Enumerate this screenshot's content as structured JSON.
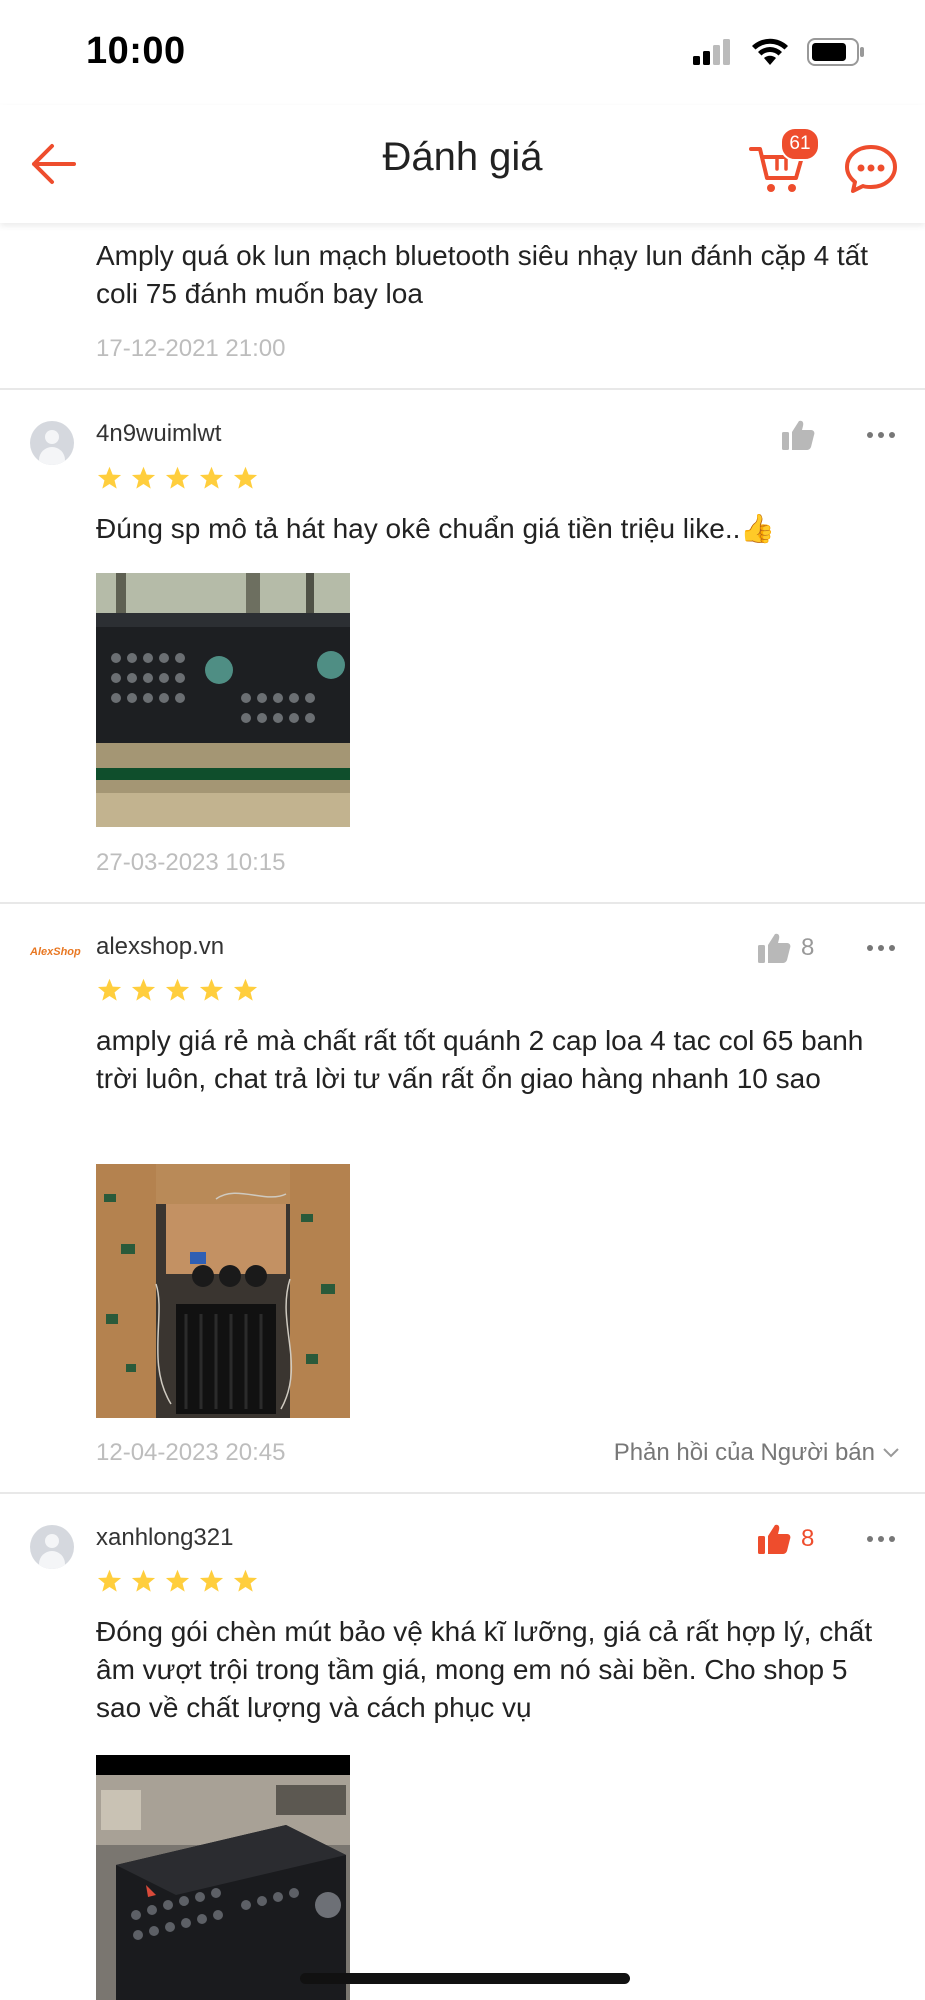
{
  "status_bar": {
    "time": "10:00"
  },
  "header": {
    "title": "Đánh giá",
    "cart_count": "61"
  },
  "colors": {
    "accent": "#ee4d2d",
    "star": "#ffce3d",
    "muted": "#bdbdbd"
  },
  "reviews": [
    {
      "text": "Amply quá ok lun mạch bluetooth siêu nhạy lun đánh cặp 4 tất coli 75 đánh muốn bay loa",
      "date": "17-12-2021 21:00"
    },
    {
      "username": "4n9wuimlwt",
      "rating": 5,
      "text": "Đúng sp mô tả  hát hay okê chuẩn giá tiền triệu like..👍",
      "date": "27-03-2023 10:15",
      "likes": "",
      "photo": "amplifier-front-photo"
    },
    {
      "username": "alexshop.vn",
      "avatar_text": "AlexShop",
      "rating": 5,
      "text": "amply giá rẻ mà chất rất tốt quánh 2 cap loa 4 tac col 65 banh trời luôn, chat trả lời tư vấn rất ổn giao hàng nhanh 10 sao",
      "date": "12-04-2023 20:45",
      "likes": "8",
      "seller_reply": "Phản hồi của Người bán",
      "photo": "amplifier-circuit-photo"
    },
    {
      "username": "xanhlong321",
      "rating": 5,
      "text": "Đóng gói chèn mút bảo vệ khá kĩ lưỡng, giá cả rất hợp lý, chất âm vượt trội trong tầm giá, mong em nó sài bền. Cho shop 5 sao về chất lượng và cách phục vụ",
      "likes": "8",
      "liked": true,
      "photo": "amplifier-box-photo"
    }
  ]
}
